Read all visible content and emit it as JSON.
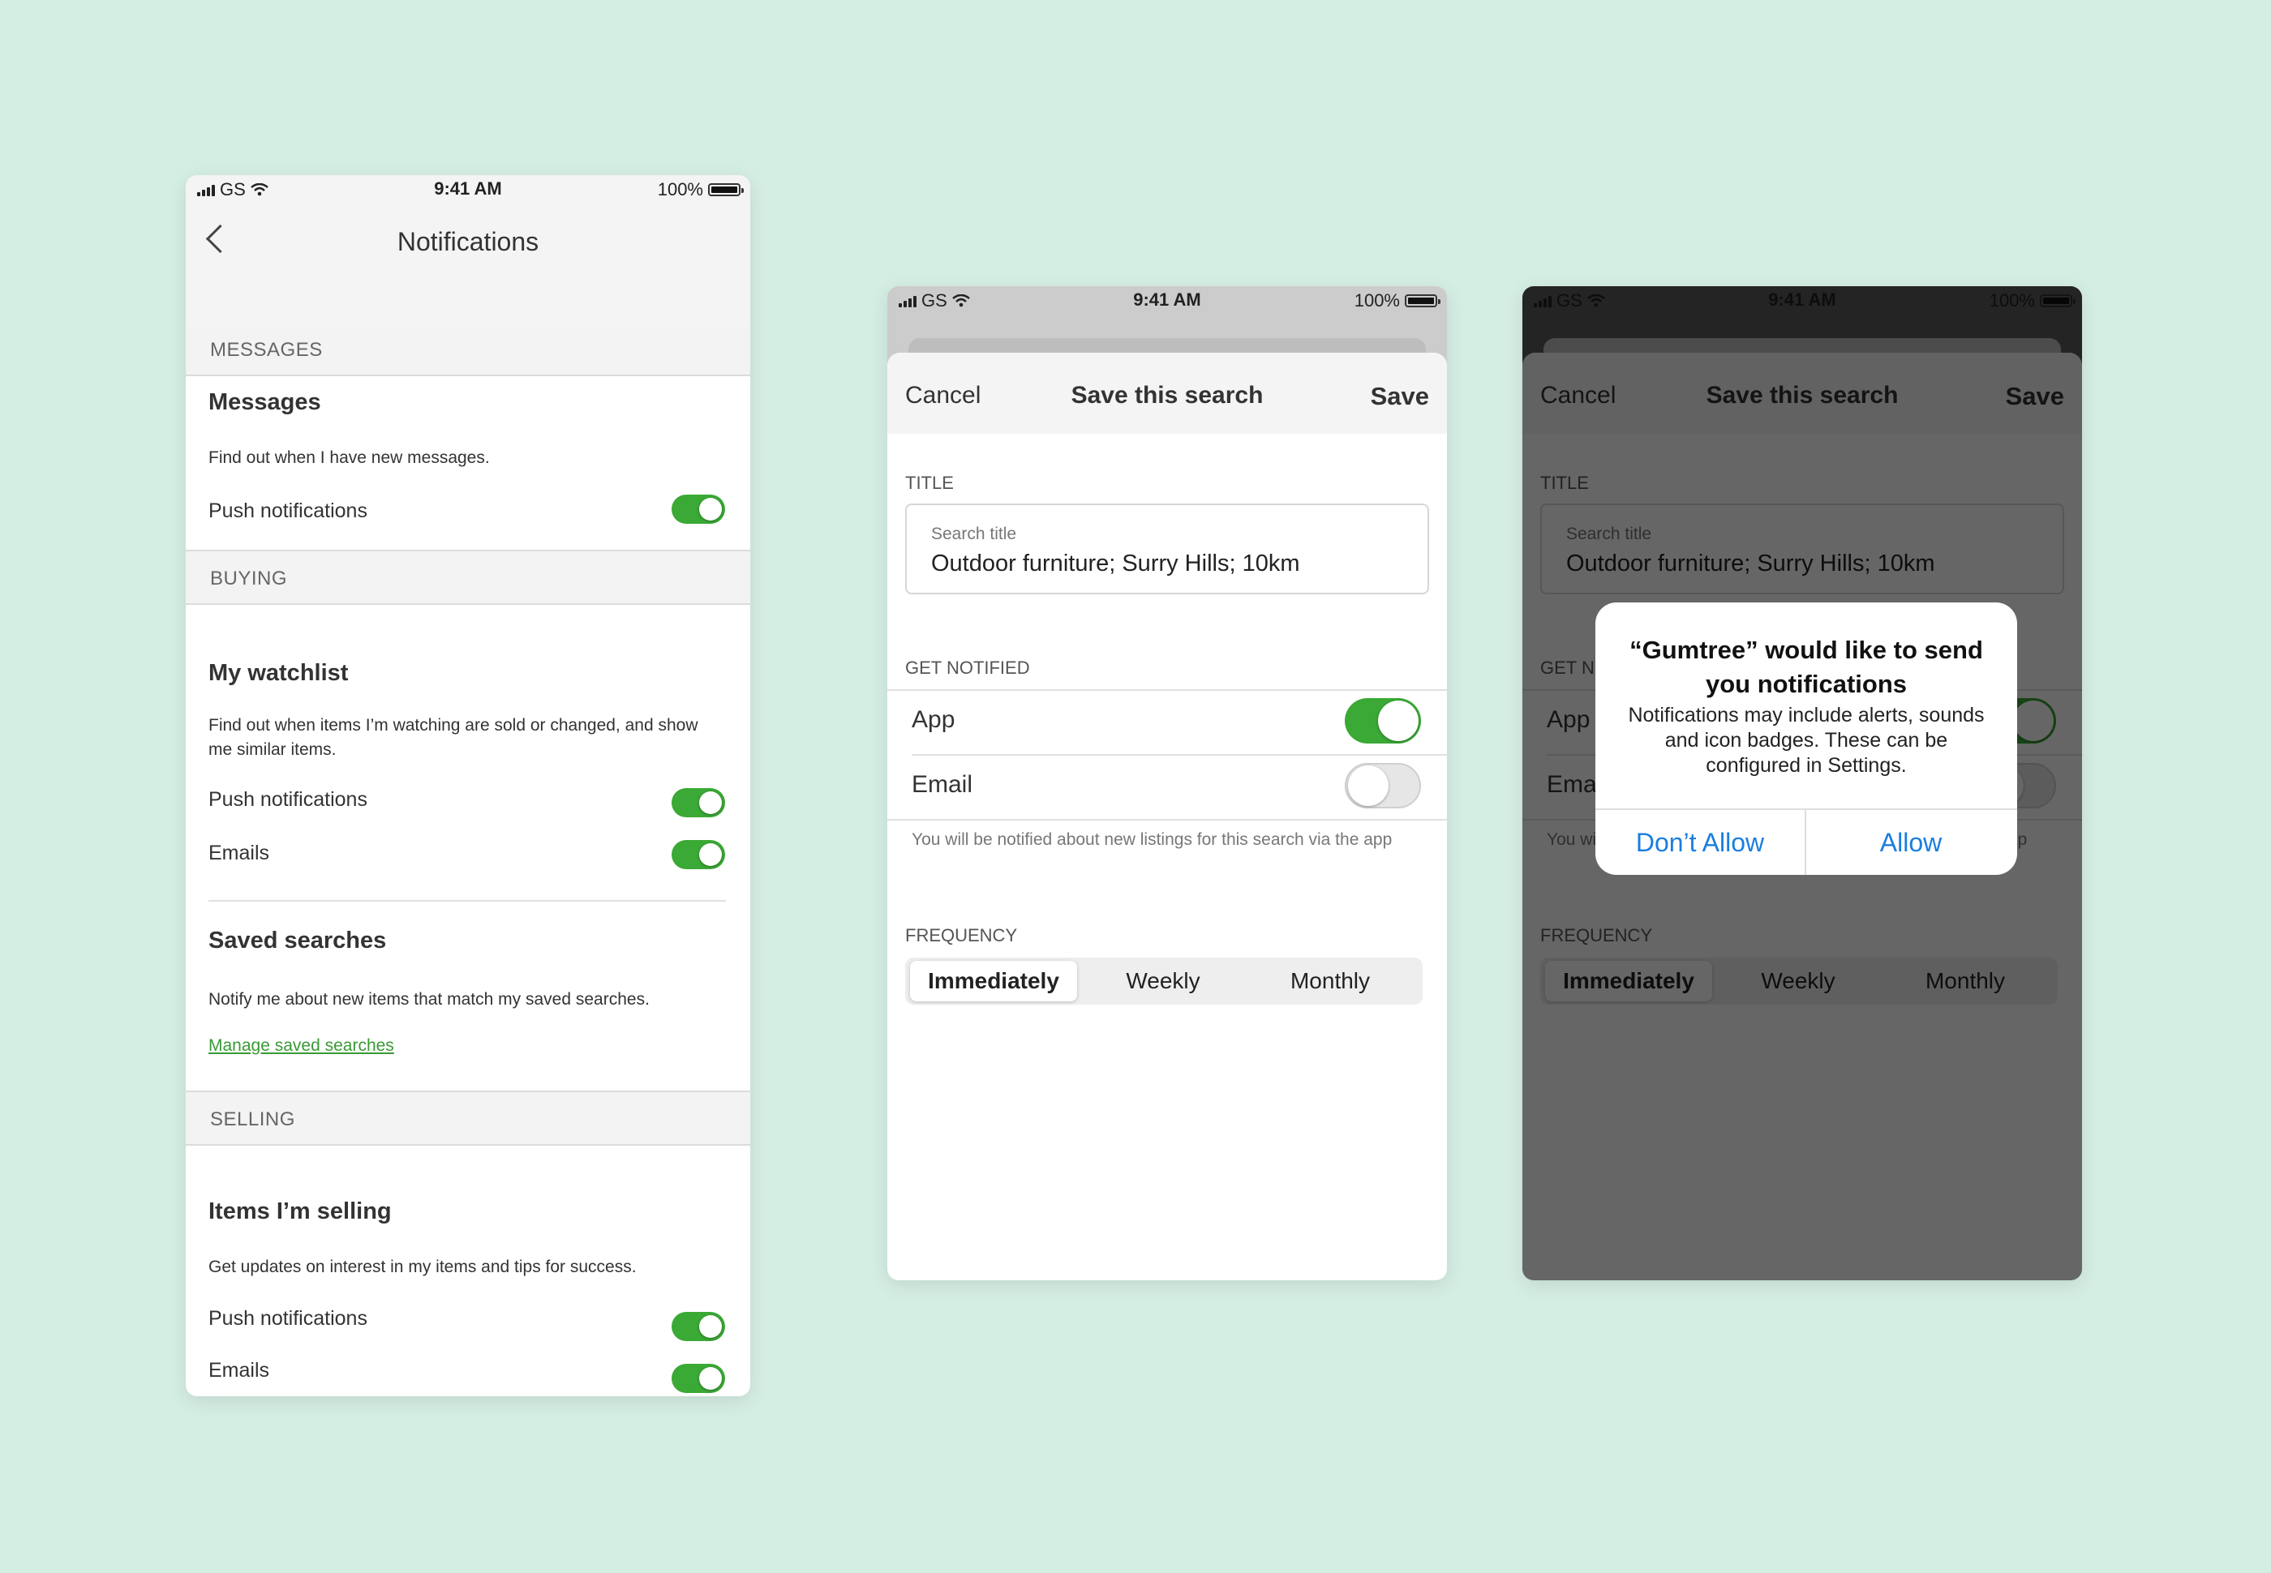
{
  "status_bar": {
    "carrier": "GS",
    "time": "9:41 AM",
    "battery": "100%"
  },
  "notifications_screen": {
    "title": "Notifications",
    "sections": {
      "messages": {
        "header": "MESSAGES",
        "title": "Messages",
        "description": "Find out when I have new messages.",
        "push_label": "Push notifications",
        "push_on": true
      },
      "buying": {
        "header": "BUYING",
        "watchlist_title": "My watchlist",
        "watchlist_description": "Find out when items I’m watching are sold or changed, and show me similar items.",
        "push_label": "Push notifications",
        "emails_label": "Emails",
        "saved_title": "Saved searches",
        "saved_description": "Notify me about new items that match my saved searches.",
        "manage_link": "Manage saved searches"
      },
      "selling": {
        "header": "SELLING",
        "title": "Items I’m selling",
        "description": "Get updates on interest in my items and tips for success.",
        "push_label": "Push notifications",
        "emails_label": "Emails"
      }
    }
  },
  "save_search": {
    "cancel": "Cancel",
    "title": "Save this search",
    "save": "Save",
    "title_section": "TITLE",
    "field_placeholder": "Search title",
    "field_value": "Outdoor furniture; Surry Hills; 10km",
    "get_notified_section": "GET NOTIFIED",
    "app_label": "App",
    "app_on": true,
    "email_label": "Email",
    "email_on": false,
    "hint": "You will be notified about new listings for this search via the app",
    "frequency_section": "FREQUENCY",
    "frequency_options": [
      "Immediately",
      "Weekly",
      "Monthly"
    ],
    "frequency_selected": "Immediately"
  },
  "permission_alert": {
    "title": "“Gumtree” would like to send you notifications",
    "message": "Notifications may include alerts, sounds and icon badges. These can be configured in Settings.",
    "deny": "Don’t Allow",
    "allow": "Allow"
  },
  "colors": {
    "background": "#d5eee3",
    "toggle_on": "#3aa935",
    "link": "#3a9a35",
    "ios_blue": "#1a7ee0"
  },
  "icons": [
    "back-chevron-icon",
    "signal-icon",
    "wifi-icon",
    "battery-icon"
  ]
}
